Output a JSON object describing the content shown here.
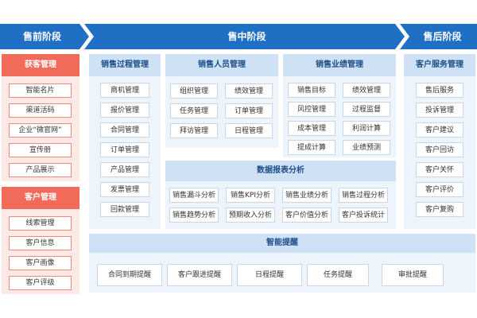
{
  "stages": {
    "pre": "售前阶段",
    "mid": "售中阶段",
    "post": "售后阶段"
  },
  "colors": {
    "header_blue": "#1f6fc4",
    "accent_red": "#f26a5a",
    "panel_blue": "#e6f0fa"
  },
  "pre_sales": {
    "acquire": {
      "title": "获客管理",
      "items": [
        "智能名片",
        "渠道活码",
        "企业“微官网”",
        "宣传册",
        "产品展示"
      ]
    },
    "customer": {
      "title": "客户管理",
      "items": [
        "线索管理",
        "客户信息",
        "客户画像",
        "客户评级"
      ]
    }
  },
  "mid_sales": {
    "process": {
      "title": "销售过程管理",
      "items": [
        "商机管理",
        "报价管理",
        "合同管理",
        "订单管理",
        "产品管理",
        "发票管理",
        "回款管理"
      ]
    },
    "staff": {
      "title": "销售人员管理",
      "items": [
        "组织管理",
        "绩效管理",
        "任务管理",
        "订单管理",
        "拜访管理",
        "日程管理"
      ]
    },
    "performance": {
      "title": "销售业绩管理",
      "items": [
        "销售目标",
        "绩效管理",
        "风控管理",
        "过程监督",
        "成本管理",
        "利润计算",
        "提成计算",
        "业绩预测"
      ]
    },
    "report": {
      "title": "数据报表分析",
      "items": [
        "销售漏斗分析",
        "销售KPI分析",
        "销售业绩分析",
        "销售过程分析",
        "销售趋势分析",
        "预期收入分析",
        "客户价值分析",
        "客户投诉统计"
      ]
    }
  },
  "post_sales": {
    "service": {
      "title": "客户服务管理",
      "items": [
        "售后服务",
        "投诉管理",
        "客户建议",
        "客户回访",
        "客户关怀",
        "客户评价",
        "客户复购"
      ]
    }
  },
  "smart_reminder": {
    "title": "智能提醒",
    "items": [
      "合同到期提醒",
      "客户跟进提醒",
      "日程提醒",
      "任务提醒",
      "审批提醒"
    ]
  }
}
